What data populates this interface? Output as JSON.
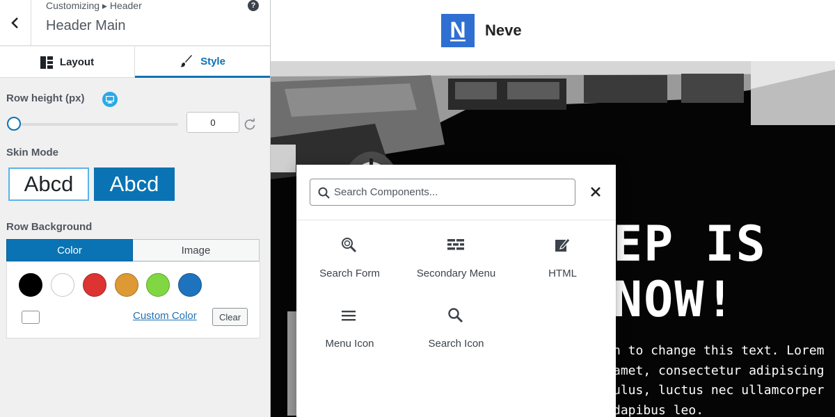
{
  "customizer": {
    "breadcrumb": "Customizing ▸ Header",
    "panel_title": "Header Main",
    "help_glyph": "?",
    "tabs": [
      {
        "label": "Layout",
        "icon": "layout-grid-icon",
        "active": false
      },
      {
        "label": "Style",
        "icon": "paintbrush-icon",
        "active": true
      }
    ],
    "row_height": {
      "label": "Row height (px)",
      "value": "0",
      "device_icon": "desktop-icon"
    },
    "skin_mode": {
      "label": "Skin Mode",
      "options": [
        "Abcd",
        "Abcd"
      ],
      "selected": "light"
    },
    "row_background": {
      "label": "Row Background",
      "tabs": [
        "Color",
        "Image"
      ],
      "active_tab": "Color",
      "swatches": [
        "#000000",
        "#ffffff",
        "#dd3333",
        "#dd9933",
        "#81d742",
        "#1e73be"
      ],
      "custom_color_link": "Custom Color",
      "clear_button": "Clear"
    }
  },
  "site": {
    "logo_letter": "N",
    "name": "Neve",
    "hero_title_lines": [
      "EP IS",
      "NOW!"
    ],
    "hero_body_lines": [
      "n to change this text. Lorem",
      "amet, consectetur adipiscing",
      "ulus, luctus nec ullamcorper",
      "dapibus leo."
    ]
  },
  "component_picker": {
    "search_placeholder": "Search Components...",
    "components": [
      {
        "label": "Search Form",
        "icon": "search-form-icon"
      },
      {
        "label": "Secondary Menu",
        "icon": "secondary-menu-icon"
      },
      {
        "label": "HTML",
        "icon": "html-edit-icon"
      },
      {
        "label": "Menu Icon",
        "icon": "hamburger-menu-icon"
      },
      {
        "label": "Search Icon",
        "icon": "search-icon"
      }
    ]
  },
  "colors": {
    "accent": "#0a73b4",
    "logo": "#2f6fd1",
    "device_badge": "#29a9e6"
  }
}
